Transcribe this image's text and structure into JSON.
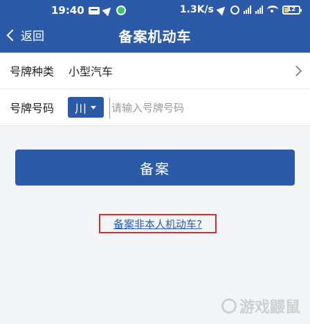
{
  "status_bar": {
    "time": "19:40",
    "network_speed": "1.3K/s",
    "signal_label_1": "HD",
    "signal_label_2": "HD",
    "battery": "12",
    "icons": [
      "message-icon",
      "send-icon",
      "app-icon",
      "alarm-icon",
      "signal-icon",
      "wifi-icon",
      "battery-icon"
    ]
  },
  "header": {
    "back_label": "返回",
    "title": "备案机动车",
    "background": "#2b5ba8"
  },
  "form": {
    "plate_type_label": "号牌种类",
    "plate_type_value": "小型汽车",
    "plate_number_label": "号牌号码",
    "province": "川",
    "plate_number_placeholder": "请输入号牌号码",
    "plate_number_value": ""
  },
  "actions": {
    "submit_label": "备案",
    "other_vehicle_link": "备案非本人机动车?"
  },
  "watermark": {
    "text": "游戏鼹鼠"
  },
  "colors": {
    "accent": "#2b5ba8",
    "highlight_box": "#d32f2f",
    "page_background": "#f3f4f6"
  }
}
